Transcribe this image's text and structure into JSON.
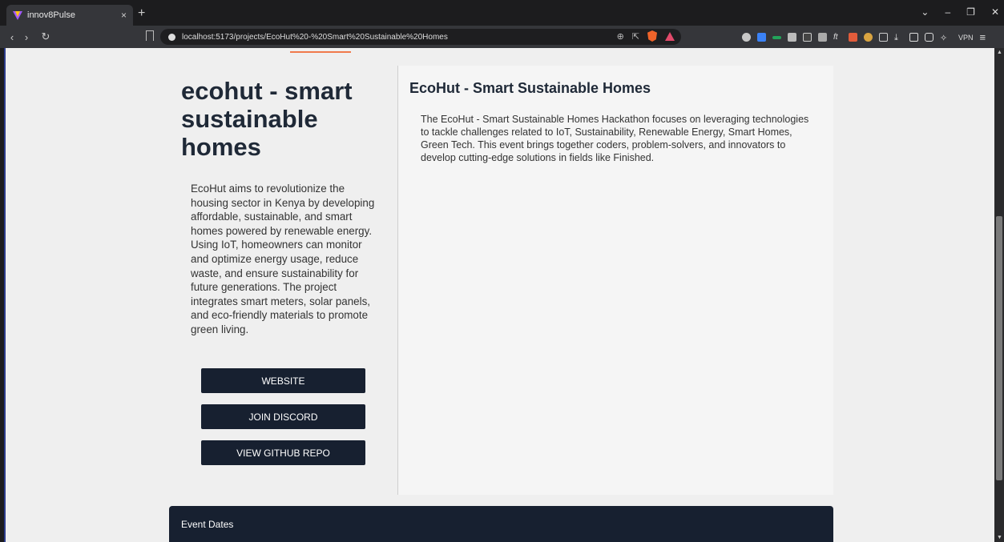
{
  "browser": {
    "tab_title": "innov8Pulse",
    "tab_close": "×",
    "new_tab": "+",
    "url": "localhost:5173/projects/EcoHut%20-%20Smart%20Sustainable%20Homes",
    "vpn_label": "VPN",
    "window_controls": [
      "⌄",
      "–",
      "❐",
      "✕"
    ]
  },
  "project": {
    "title": "ecohut - smart sustainable homes",
    "description": "EcoHut aims to revolutionize the housing sector in Kenya by developing affordable, sustainable, and smart homes powered by renewable energy. Using IoT, homeowners can monitor and optimize energy usage, reduce waste, and ensure sustainability for future generations. The project integrates smart meters, solar panels, and eco-friendly materials to promote green living.",
    "buttons": {
      "website": "WEBSITE",
      "discord": "JOIN DISCORD",
      "github": "VIEW GITHUB REPO"
    }
  },
  "hackathon": {
    "title": "EcoHut - Smart Sustainable Homes",
    "description": "The EcoHut - Smart Sustainable Homes Hackathon focuses on leveraging technologies to tackle challenges related to IoT, Sustainability, Renewable Energy, Smart Homes, Green Tech. This event brings together coders, problem-solvers, and innovators to develop cutting-edge solutions in fields like Finished."
  },
  "event_dates": {
    "label": "Event Dates"
  },
  "colors": {
    "accent": "#f07a4c",
    "button_bg": "#172030",
    "page_bg": "#efefef"
  }
}
